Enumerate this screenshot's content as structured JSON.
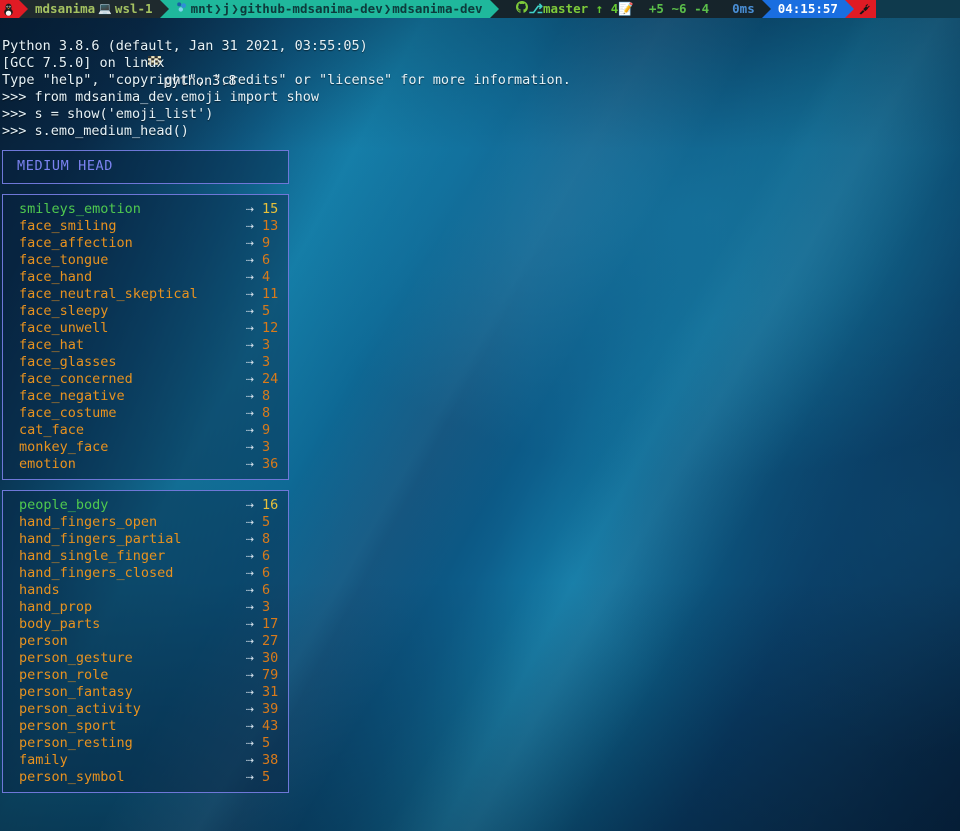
{
  "statusbar": {
    "left_icon": "tux-icon",
    "user": "mdsanima",
    "host_icon": "laptop-icon",
    "host": "wsl-1",
    "path_icon": "wsl-icon",
    "path_segments": [
      "mnt",
      "j",
      "github-mdsanima-dev",
      "mdsanima-dev"
    ],
    "git_icon": "github-icon",
    "branch_icon": "git-branch-icon",
    "branch": "master",
    "ahead_icon": "arrow-up-icon",
    "ahead": "4",
    "pencil_icon": "pencil-edit-icon",
    "added": "+5",
    "modified": "~6",
    "deleted": "-4",
    "duration": "0ms",
    "clock": "04:15:57",
    "right_icon": "plug-icon"
  },
  "terminal": {
    "title_icon": "checkered-flag-icon",
    "title": "python3.8",
    "lines": [
      "Python 3.8.6 (default, Jan 31 2021, 03:55:05)",
      "[GCC 7.5.0] on linux",
      "Type \"help\", \"copyright\", \"credits\" or \"license\" for more information.",
      ">>> from mdsanima_dev.emoji import show",
      ">>> s = show('emoji_list')",
      ">>> s.emo_medium_head()"
    ]
  },
  "panels": [
    {
      "type": "header",
      "title": "MEDIUM HEAD"
    },
    {
      "type": "table",
      "arrow": "⇢",
      "rows": [
        {
          "name": "smileys_emotion",
          "value": "15"
        },
        {
          "name": "face_smiling",
          "value": "13"
        },
        {
          "name": "face_affection",
          "value": "9"
        },
        {
          "name": "face_tongue",
          "value": "6"
        },
        {
          "name": "face_hand",
          "value": "4"
        },
        {
          "name": "face_neutral_skeptical",
          "value": "11"
        },
        {
          "name": "face_sleepy",
          "value": "5"
        },
        {
          "name": "face_unwell",
          "value": "12"
        },
        {
          "name": "face_hat",
          "value": "3"
        },
        {
          "name": "face_glasses",
          "value": "3"
        },
        {
          "name": "face_concerned",
          "value": "24"
        },
        {
          "name": "face_negative",
          "value": "8"
        },
        {
          "name": "face_costume",
          "value": "8"
        },
        {
          "name": "cat_face",
          "value": "9"
        },
        {
          "name": "monkey_face",
          "value": "3"
        },
        {
          "name": "emotion",
          "value": "36"
        }
      ]
    },
    {
      "type": "table",
      "arrow": "⇢",
      "rows": [
        {
          "name": "people_body",
          "value": "16"
        },
        {
          "name": "hand_fingers_open",
          "value": "5"
        },
        {
          "name": "hand_fingers_partial",
          "value": "8"
        },
        {
          "name": "hand_single_finger",
          "value": "6"
        },
        {
          "name": "hand_fingers_closed",
          "value": "6"
        },
        {
          "name": "hands",
          "value": "6"
        },
        {
          "name": "hand_prop",
          "value": "3"
        },
        {
          "name": "body_parts",
          "value": "17"
        },
        {
          "name": "person",
          "value": "27"
        },
        {
          "name": "person_gesture",
          "value": "30"
        },
        {
          "name": "person_role",
          "value": "79"
        },
        {
          "name": "person_fantasy",
          "value": "31"
        },
        {
          "name": "person_activity",
          "value": "39"
        },
        {
          "name": "person_sport",
          "value": "43"
        },
        {
          "name": "person_resting",
          "value": "5"
        },
        {
          "name": "family",
          "value": "38"
        },
        {
          "name": "person_symbol",
          "value": "5"
        }
      ]
    }
  ],
  "colors": {
    "panel_border": "#6e77d8",
    "head_text": "#7b82f0",
    "first_row_name": "#4fc94f",
    "first_row_value": "#e8c13a",
    "row_name": "#e8921f",
    "row_value": "#d97a1a",
    "arrow": "#cddbe6",
    "status_red": "#e01b24",
    "status_path": "#1fb89c",
    "status_time": "#1a6ee0",
    "status_git_text": "#7ecb3a"
  }
}
